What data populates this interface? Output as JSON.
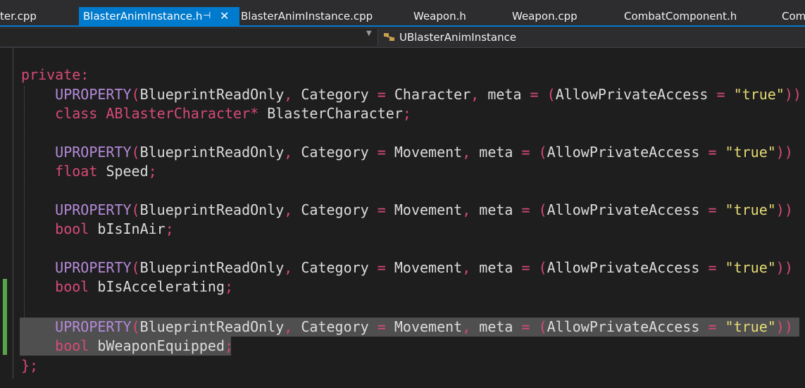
{
  "tabs": [
    {
      "label": "ter.cpp",
      "active": false
    },
    {
      "label": "BlasterAnimInstance.h",
      "active": true,
      "pin": "⊣",
      "close": "✕"
    },
    {
      "label": "BlasterAnimInstance.cpp",
      "active": false
    },
    {
      "label": "Weapon.h",
      "active": false
    },
    {
      "label": "Weapon.cpp",
      "active": false
    },
    {
      "label": "CombatComponent.h",
      "active": false
    },
    {
      "label": "Com",
      "active": false
    }
  ],
  "navbar": {
    "class_label": "UBlasterAnimInstance",
    "class_icon": "class-members-icon",
    "dropdown_icon": "chevron-down-icon"
  },
  "colors": {
    "accent": "#007acc",
    "keyword": "#d84a77",
    "macro": "#b48ad8",
    "string": "#e6db74",
    "text": "#dcdcdc",
    "background": "#1e1e1e",
    "change_bar": "#57a64a",
    "selection": "#4f4f4f"
  },
  "code": {
    "private_kw": "private:",
    "blocks": [
      {
        "macro": "UPROPERTY",
        "spec": "BlueprintReadOnly",
        "category_kw": "Category",
        "category": "Character",
        "meta_kw": "meta",
        "access": "AllowPrivateAccess",
        "value": "\"true\"",
        "decl_type": "class ABlasterCharacter*",
        "decl_name": "BlasterCharacter"
      },
      {
        "macro": "UPROPERTY",
        "spec": "BlueprintReadOnly",
        "category_kw": "Category",
        "category": "Movement",
        "meta_kw": "meta",
        "access": "AllowPrivateAccess",
        "value": "\"true\"",
        "decl_type": "float",
        "decl_name": "Speed"
      },
      {
        "macro": "UPROPERTY",
        "spec": "BlueprintReadOnly",
        "category_kw": "Category",
        "category": "Movement",
        "meta_kw": "meta",
        "access": "AllowPrivateAccess",
        "value": "\"true\"",
        "decl_type": "bool",
        "decl_name": "bIsInAir"
      },
      {
        "macro": "UPROPERTY",
        "spec": "BlueprintReadOnly",
        "category_kw": "Category",
        "category": "Movement",
        "meta_kw": "meta",
        "access": "AllowPrivateAccess",
        "value": "\"true\"",
        "decl_type": "bool",
        "decl_name": "bIsAccelerating"
      },
      {
        "macro": "UPROPERTY",
        "spec": "BlueprintReadOnly",
        "category_kw": "Category",
        "category": "Movement",
        "meta_kw": "meta",
        "access": "AllowPrivateAccess",
        "value": "\"true\"",
        "decl_type": "bool",
        "decl_name": "bWeaponEquipped"
      }
    ],
    "closing": "};"
  }
}
